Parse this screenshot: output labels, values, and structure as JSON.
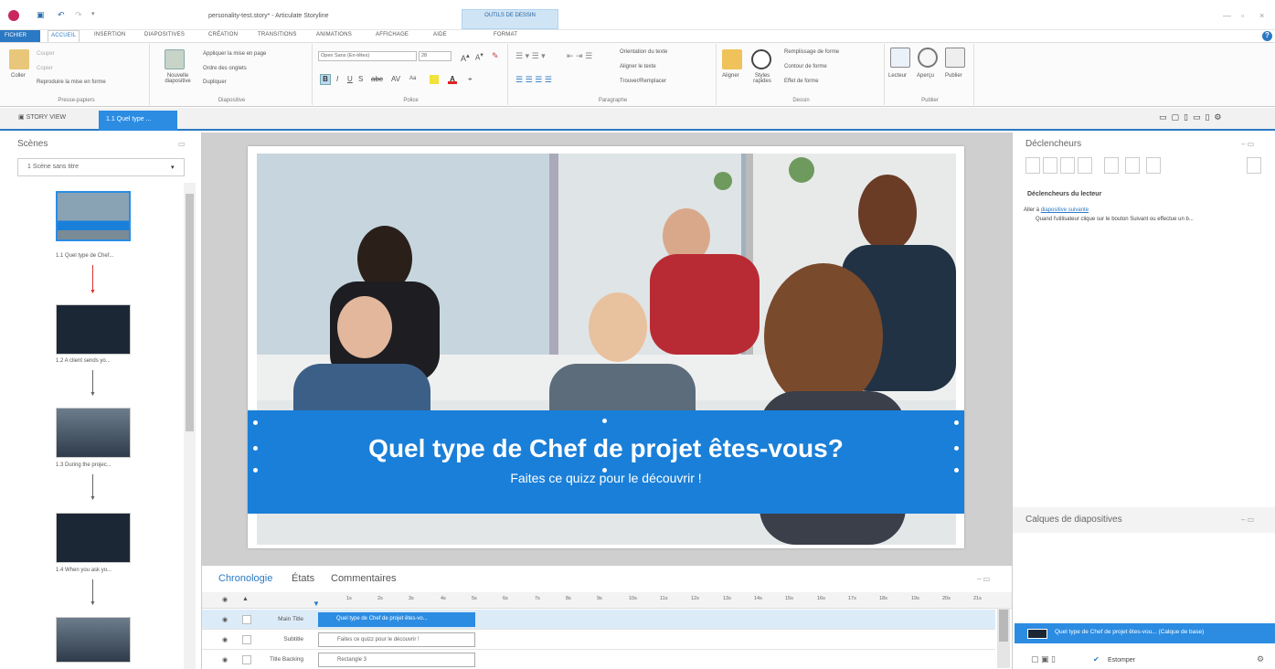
{
  "titlebar": {
    "doc_title": "personality-test.story* - Articulate Storyline",
    "context_tab": "OUTILS DE DESSIN",
    "minimize": "—",
    "restore": "▫",
    "close": "×",
    "help": "?"
  },
  "menu": {
    "file": "FICHIER",
    "items": [
      "ACCUEIL",
      "INSERTION",
      "DIAPOSITIVES",
      "CRÉATION",
      "TRANSITIONS",
      "ANIMATIONS",
      "AFFICHAGE",
      "AIDE"
    ],
    "context": "FORMAT"
  },
  "ribbon": {
    "clipboard": {
      "paste": "Coller",
      "cut": "Couper",
      "copy": "Copier",
      "format_painter": "Reproduire la mise en forme",
      "label": "Presse-papiers"
    },
    "slides": {
      "new_slide": "Nouvelle diapositive",
      "apply_layout": "Appliquer la mise en page",
      "tab_order": "Ordre des onglets",
      "duplicate": "Dupliquer",
      "label": "Diapositive"
    },
    "font": {
      "family": "Open Sans (En-têtes)",
      "size": "28",
      "aa": "Aa",
      "label": "Police"
    },
    "paragraph": {
      "text_direction": "Orientation du texte",
      "align_text": "Aligner le texte",
      "find_replace": "Trouver/Remplacer",
      "label": "Paragraphe"
    },
    "drawing": {
      "align": "Aligner",
      "styles": "Styles rapides",
      "shape_fill": "Remplissage de forme",
      "shape_outline": "Contour de forme",
      "shape_effect": "Effet de forme",
      "label": "Dessin"
    },
    "publish": {
      "player": "Lecteur",
      "preview": "Aperçu",
      "publish": "Publier",
      "label": "Publier"
    }
  },
  "tabs": {
    "story_view": "STORY VIEW",
    "slide_tab": "1.1 Quel type ..."
  },
  "scenes": {
    "title": "Scènes",
    "selected": "1 Scène sans titre",
    "items": [
      {
        "label": "1.1 Quel type de Chef..."
      },
      {
        "label": "1.2 A client sends yo..."
      },
      {
        "label": "1.3 During the projec..."
      },
      {
        "label": "1.4 When you ask yo..."
      }
    ]
  },
  "slide": {
    "title": "Quel type de Chef de projet êtes-vous?",
    "subtitle": "Faites ce quizz pour le découvrir !"
  },
  "triggers": {
    "title": "Déclencheurs",
    "player_heading": "Déclencheurs du lecteur",
    "goto_prefix": "Aller à",
    "goto_link": "diapositive suivante",
    "condition": "Quand l'utilisateur clique sur le bouton Suivant ou effectue un b..."
  },
  "layers": {
    "title": "Calques de diapositives",
    "base_layer": "Quel type de Chef de projet êtes-vou... (Calque de base)",
    "dim_label": "Estomper"
  },
  "timeline": {
    "tabs": [
      "Chronologie",
      "États",
      "Commentaires"
    ],
    "ticks": [
      "1s",
      "2s",
      "3s",
      "4s",
      "5s",
      "6s",
      "7s",
      "8s",
      "9s",
      "10s",
      "11s",
      "12s",
      "13s",
      "14s",
      "15s",
      "16s",
      "17s",
      "18s",
      "19s",
      "20s",
      "21s"
    ],
    "rows": [
      {
        "name": "Main Title",
        "bar": "Quel type de Chef de projet êtes-vo..."
      },
      {
        "name": "Subtitle",
        "bar": "Faites ce quizz pour le découvrir !"
      },
      {
        "name": "Title Backing",
        "bar": "Rectangle 3"
      }
    ]
  },
  "colors": {
    "accent": "#2b79c4",
    "banner": "#1a7fd8",
    "logo": "#c8285e"
  }
}
